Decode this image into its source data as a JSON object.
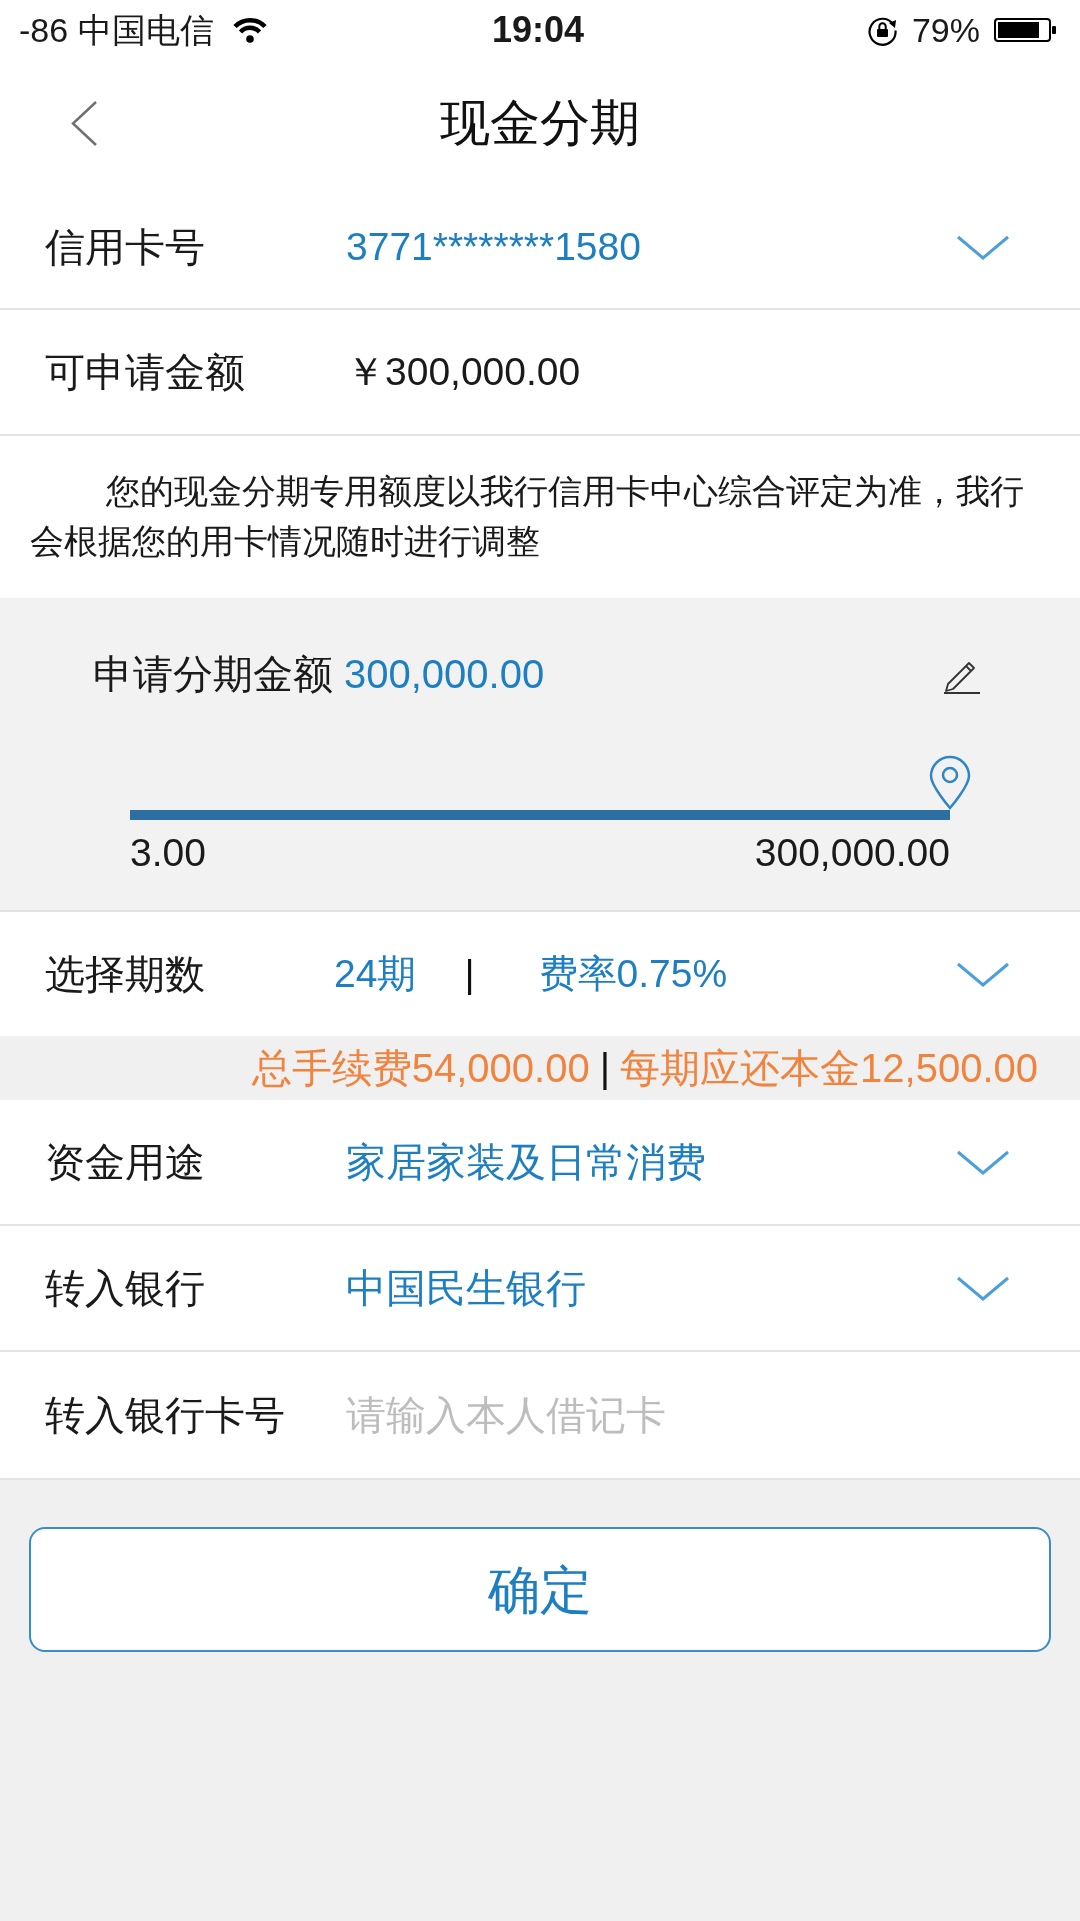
{
  "status_bar": {
    "carrier": "-86 中国电信",
    "time": "19:04",
    "battery": "79%"
  },
  "nav": {
    "title": "现金分期"
  },
  "card_row": {
    "label": "信用卡号",
    "value": "3771********1580"
  },
  "available_row": {
    "label": "可申请金额",
    "value": "￥300,000.00"
  },
  "note": "您的现金分期专用额度以我行信用卡中心综合评定为准，我行会根据您的用卡情况随时进行调整",
  "amount": {
    "label": "申请分期金额",
    "value": "300,000.00",
    "level": 1,
    "min": "3.00",
    "max": "300,000.00"
  },
  "term_row": {
    "label": "选择期数",
    "term": "24期",
    "separator": "|",
    "rate": "费率0.75%"
  },
  "fee_summary": {
    "total_fee": "总手续费54,000.00",
    "separator": "|",
    "per_period": "每期应还本金12,500.00"
  },
  "purpose_row": {
    "label": "资金用途",
    "value": "家居家装及日常消费"
  },
  "bank_row": {
    "label": "转入银行",
    "value": "中国民生银行"
  },
  "card_number_row": {
    "label": "转入银行卡号",
    "placeholder": "请输入本人借记卡"
  },
  "confirm_button": "确定"
}
